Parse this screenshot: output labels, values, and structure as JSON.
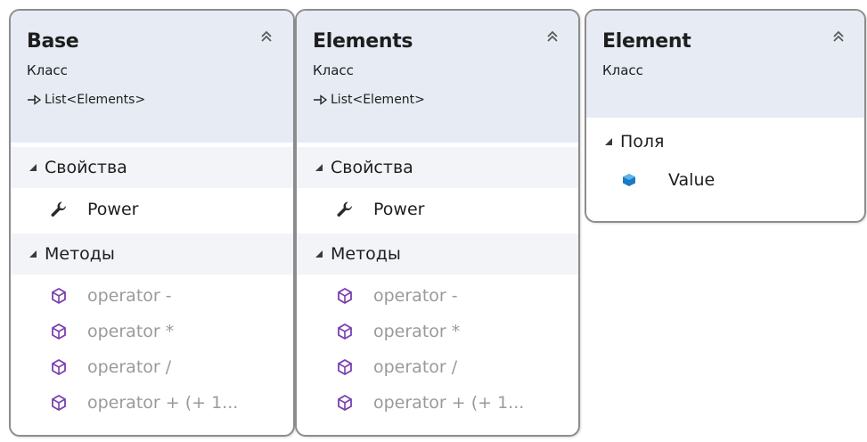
{
  "boxes": [
    {
      "title": "Base",
      "stereotype": "Класс",
      "base_type": "List<Elements>",
      "sections": [
        {
          "label": "Свойства",
          "members": [
            {
              "label": "Power",
              "icon": "wrench-icon"
            }
          ]
        },
        {
          "label": "Методы",
          "members": [
            {
              "label": "operator -",
              "icon": "method-cube-icon"
            },
            {
              "label": "operator *",
              "icon": "method-cube-icon"
            },
            {
              "label": "operator /",
              "icon": "method-cube-icon"
            },
            {
              "label": "operator + (+ 1...",
              "icon": "method-cube-icon"
            }
          ]
        }
      ]
    },
    {
      "title": "Elements",
      "stereotype": "Класс",
      "base_type": "List<Element>",
      "sections": [
        {
          "label": "Свойства",
          "members": [
            {
              "label": "Power",
              "icon": "wrench-icon"
            }
          ]
        },
        {
          "label": "Методы",
          "members": [
            {
              "label": "operator -",
              "icon": "method-cube-icon"
            },
            {
              "label": "operator *",
              "icon": "method-cube-icon"
            },
            {
              "label": "operator /",
              "icon": "method-cube-icon"
            },
            {
              "label": "operator + (+ 1...",
              "icon": "method-cube-icon"
            }
          ]
        }
      ]
    },
    {
      "title": "Element",
      "stereotype": "Класс",
      "sections": [
        {
          "label": "Поля",
          "members": [
            {
              "label": "Value",
              "icon": "field-icon"
            }
          ]
        }
      ]
    }
  ],
  "colors": {
    "header_bg": "#e6ebf4",
    "section_bg": "#f3f4f8",
    "border": "#8d8d8d",
    "method_icon": "#7a3fb0",
    "field_icon": "#1c7ac4",
    "operator_text": "#9a9a9a"
  }
}
